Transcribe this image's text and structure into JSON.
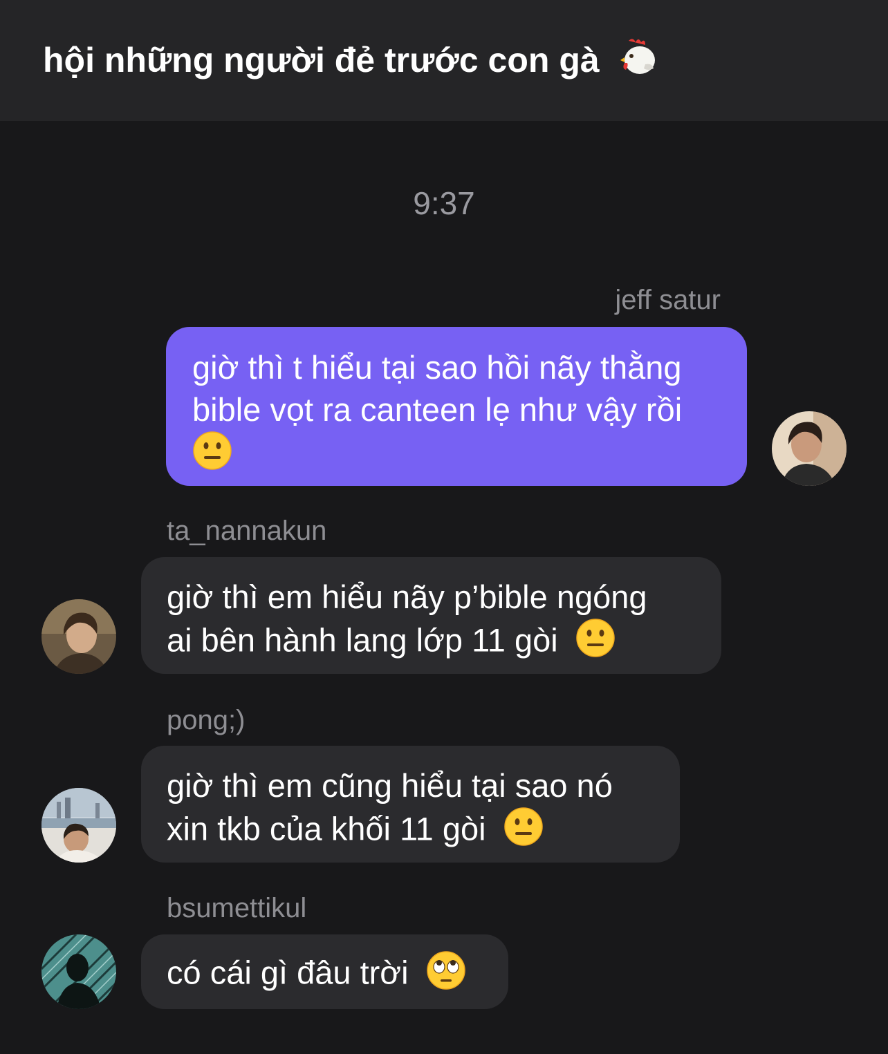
{
  "header": {
    "title": "hội những người đẻ trước con gà",
    "title_icon": "rooster-emoji-icon"
  },
  "timestamp": "9:37",
  "messages": [
    {
      "sender": "jeff satur",
      "direction": "outgoing",
      "lines": [
        "giờ thì t hiểu tại sao hồi nãy thằng",
        "bible vọt ra canteen lẹ như vậy rồi",
        ""
      ],
      "emoji": "neutral-face-emoji-icon"
    },
    {
      "sender": "ta_nannakun",
      "direction": "incoming",
      "lines": [
        "giờ thì em hiểu nãy p’bible ngóng",
        "ai bên hành lang lớp 11 gòi"
      ],
      "emoji": "neutral-face-emoji-icon"
    },
    {
      "sender": "pong;)",
      "direction": "incoming",
      "lines": [
        "giờ thì em cũng hiểu tại sao nó",
        "xin tkb của khối 11 gòi"
      ],
      "emoji": "neutral-face-emoji-icon"
    },
    {
      "sender": "bsumettikul",
      "direction": "incoming",
      "lines": [
        "có cái gì đâu trời"
      ],
      "emoji": "face-with-rolling-eyes-emoji-icon"
    }
  ],
  "colors": {
    "background": "#18181a",
    "header_bg": "#252527",
    "outgoing_bubble": "#7761f3",
    "incoming_bubble": "#2b2b2e",
    "secondary_text": "#8e8e93"
  }
}
